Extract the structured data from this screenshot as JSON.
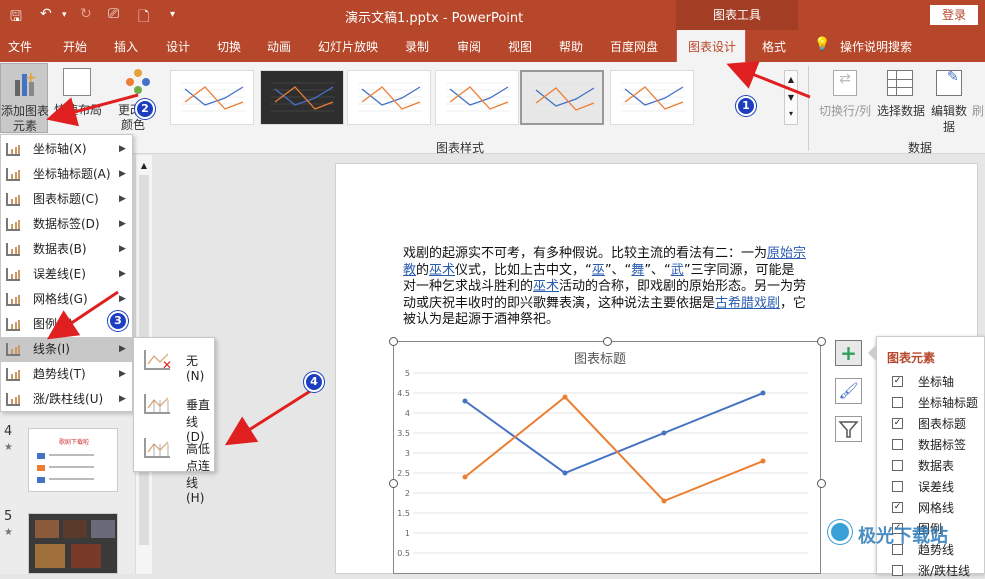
{
  "title_bar": {
    "doc_title": "演示文稿1.pptx  -  PowerPoint",
    "context_tools": "图表工具",
    "login": "登录"
  },
  "tabs": [
    "文件",
    "开始",
    "插入",
    "设计",
    "切换",
    "动画",
    "幻灯片放映",
    "录制",
    "审阅",
    "视图",
    "帮助",
    "百度网盘",
    "图表设计",
    "格式"
  ],
  "active_tab": "图表设计",
  "tell_me": "操作说明搜索",
  "ribbon": {
    "add_element_line1": "添加图表",
    "add_element_line2": "元素",
    "quick_layout_line1": "快速布局",
    "change_colors_line1": "更改",
    "change_colors_line2": "颜色",
    "styles_group": "图表样式",
    "switch_rowcol": "切换行/列",
    "select_data": "选择数据",
    "edit_data_line1": "编辑数",
    "edit_data_line2": "据",
    "refresh_partial": "刷",
    "data_group": "数据"
  },
  "menu": {
    "items": [
      {
        "label": "坐标轴(X)",
        "has_sub": true
      },
      {
        "label": "坐标轴标题(A)",
        "has_sub": true
      },
      {
        "label": "图表标题(C)",
        "has_sub": true
      },
      {
        "label": "数据标签(D)",
        "has_sub": true
      },
      {
        "label": "数据表(B)",
        "has_sub": true
      },
      {
        "label": "误差线(E)",
        "has_sub": true
      },
      {
        "label": "网格线(G)",
        "has_sub": true
      },
      {
        "label": "图例(L)",
        "has_sub": true
      },
      {
        "label": "线条(I)",
        "has_sub": true
      },
      {
        "label": "趋势线(T)",
        "has_sub": true
      },
      {
        "label": "涨/跌柱线(U)",
        "has_sub": true
      }
    ],
    "highlighted_index": 8
  },
  "submenu": {
    "items": [
      {
        "label": "无(N)"
      },
      {
        "label": "垂直线(D)"
      },
      {
        "label": "高低点连线(H)"
      }
    ]
  },
  "slides": {
    "num4": "4",
    "num5": "5",
    "thumb4_title": "歌剧下载啦"
  },
  "slide_text": {
    "p1": "戏剧的起源实不可考，有多种假说。比较主流的看法有二：一为",
    "link1": "原始宗教",
    "p2": "的",
    "link2": "巫术",
    "p3": "仪式，比如上古中文，“",
    "link3": "巫",
    "p4": "”、“",
    "link4": "舞",
    "p5": "”、“",
    "link5": "武",
    "p6": "”三字同源，可能是对一种乞求战斗胜利的",
    "link6": "巫术",
    "p7": "活动的合称，即戏剧的原始形态。另一为劳动或庆祝丰收时的即兴歌舞表演，这种说法主要依据是",
    "link7": "古希腊戏剧",
    "p8": "，它被认为是起源于酒神祭祀。"
  },
  "chart_data": {
    "type": "line",
    "title": "图表标题",
    "ylim": [
      0,
      5
    ],
    "yticks": [
      "5",
      "4.5",
      "4",
      "3.5",
      "3",
      "2.5",
      "2",
      "1.5",
      "1",
      "0.5"
    ],
    "x": [
      1,
      2,
      3,
      4
    ],
    "series": [
      {
        "values": [
          4.3,
          2.5,
          3.5,
          4.5
        ],
        "color": "#4472c4"
      },
      {
        "values": [
          2.4,
          4.4,
          1.8,
          2.8
        ],
        "color": "#ed7d31"
      }
    ],
    "grid": true
  },
  "elements_pane": {
    "title": "图表元素",
    "items": [
      {
        "label": "坐标轴",
        "checked": true
      },
      {
        "label": "坐标轴标题",
        "checked": false
      },
      {
        "label": "图表标题",
        "checked": true
      },
      {
        "label": "数据标签",
        "checked": false
      },
      {
        "label": "数据表",
        "checked": false
      },
      {
        "label": "误差线",
        "checked": false
      },
      {
        "label": "网格线",
        "checked": true
      },
      {
        "label": "图例",
        "checked": true
      },
      {
        "label": "趋势线",
        "checked": false
      },
      {
        "label": "涨/跌柱线",
        "checked": false
      }
    ]
  },
  "badges": [
    "1",
    "2",
    "3",
    "4"
  ],
  "watermark": "极光下载站",
  "colors": {
    "accent": "#b7472a",
    "badge": "#1d3fbf",
    "arrow": "#e02020"
  }
}
